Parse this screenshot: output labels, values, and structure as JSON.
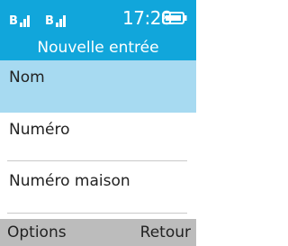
{
  "status_bar": {
    "signal_1_glyph": "B",
    "signal_2_glyph": "B",
    "time": "17:28",
    "battery_icon": "battery-icon",
    "signal_icon": "signal-icon"
  },
  "header": {
    "title": "Nouvelle entrée"
  },
  "form": {
    "fields": [
      {
        "label": "Nom",
        "selected": true
      },
      {
        "label": "Numéro",
        "selected": false
      },
      {
        "label": "Numéro maison",
        "selected": false
      }
    ]
  },
  "softkeys": {
    "left": "Options",
    "right": "Retour"
  },
  "colors": {
    "accent": "#11a6db",
    "selection": "#a7daf1",
    "softkey_bar": "#bcbcbc"
  }
}
